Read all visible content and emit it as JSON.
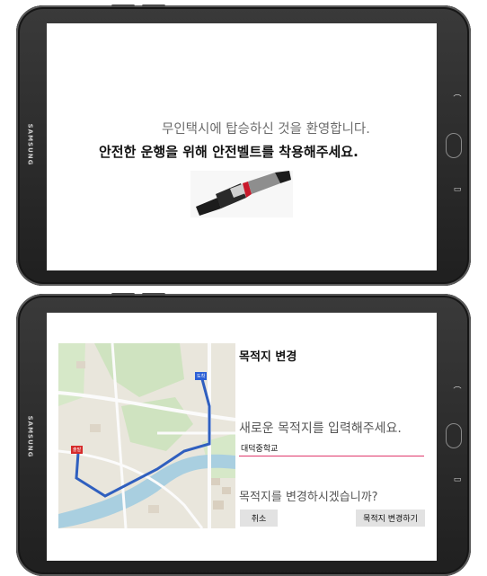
{
  "device": {
    "brand": "SAMSUNG"
  },
  "welcome_screen": {
    "welcome_text": "무인택시에 탑승하신 것을 환영합니다.",
    "seatbelt_text": "안전한 운행을 위해 안전벨트를 착용해주세요."
  },
  "destination_screen": {
    "title": "목적지 변경",
    "prompt": "새로운 목적지를 입력해주세요.",
    "input_value": "대덕중학교",
    "confirm_question": "목적지를 변경하시겠습니까?",
    "cancel_label": "취소",
    "change_label": "목적지 변경하기",
    "map_markers": {
      "start": "출발",
      "end": "도착"
    }
  },
  "colors": {
    "input_underline": "#e0386b",
    "route": "#2f5fbf",
    "start_marker": "#d62b2b",
    "end_marker": "#2b5fd6"
  },
  "icons": [
    "seatbelt-icon",
    "home-button-icon",
    "back-icon",
    "recent-apps-icon"
  ]
}
